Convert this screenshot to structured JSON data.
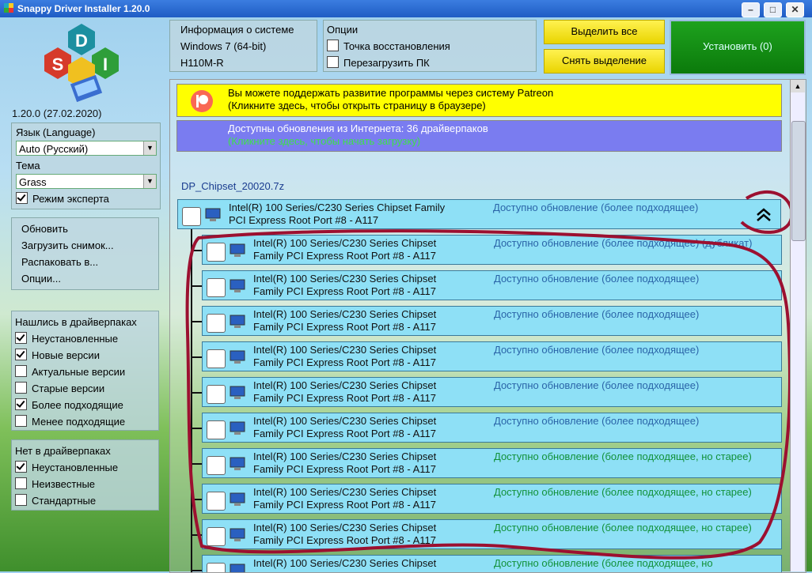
{
  "window": {
    "title": "Snappy Driver Installer 1.20.0",
    "controls": [
      "–",
      "□",
      "✕"
    ]
  },
  "version": "1.20.0 (27.02.2020)",
  "sysinfo": {
    "header": "Информация о системе",
    "os": "Windows 7 (64-bit)",
    "board": "H110M-R"
  },
  "options": {
    "header": "Опции",
    "restore_point": "Точка восстановления",
    "reboot": "Перезагрузить ПК"
  },
  "buttons": {
    "select_all": "Выделить все",
    "deselect": "Снять выделение",
    "install": "Установить (0)"
  },
  "language": {
    "label": "Язык (Language)",
    "value": "Auto (Русский)"
  },
  "theme": {
    "label": "Тема",
    "value": "Grass"
  },
  "expert_mode": "Режим эксперта",
  "menu": [
    "Обновить",
    "Загрузить снимок...",
    "Распаковать в...",
    "Опции..."
  ],
  "found": {
    "header": "Нашлись в драйверпаках",
    "items": [
      {
        "label": "Неустановленные",
        "checked": true
      },
      {
        "label": "Новые версии",
        "checked": true
      },
      {
        "label": "Актуальные версии",
        "checked": false
      },
      {
        "label": "Старые версии",
        "checked": false
      },
      {
        "label": "Более подходящие",
        "checked": true
      },
      {
        "label": "Менее подходящие",
        "checked": false
      }
    ]
  },
  "notfound": {
    "header": "Нет в драйверпаках",
    "items": [
      {
        "label": "Неустановленные",
        "checked": true
      },
      {
        "label": "Неизвестные",
        "checked": false
      },
      {
        "label": "Стандартные",
        "checked": false
      }
    ]
  },
  "patreon": {
    "line1": "Вы можете поддержать развитие программы через систему Patreon",
    "line2": "(Кликните здесь, чтобы открыть страницу в браузере)"
  },
  "updates": {
    "line1": "Доступны обновления из Интернета: 36 драйверпаков",
    "line2": "(Кликните здесь, чтобы начать загрузку)"
  },
  "driverpack": "DP_Chipset_20020.7z",
  "group": {
    "line1": "Intel(R) 100 Series/C230 Series Chipset Family",
    "line2": "PCI Express Root Port #8 - A117",
    "status": "Доступно обновление (более подходящее)"
  },
  "drivers": [
    {
      "line1": "Intel(R) 100 Series/C230 Series Chipset",
      "line2": "Family PCI Express Root Port #8 - A117",
      "status": "Доступно обновление (более подходящее) (дубликат)",
      "color": "blue"
    },
    {
      "line1": "Intel(R) 100 Series/C230 Series Chipset",
      "line2": "Family PCI Express Root Port #8 - A117",
      "status": "Доступно обновление (более подходящее)",
      "color": "blue"
    },
    {
      "line1": "Intel(R) 100 Series/C230 Series Chipset",
      "line2": "Family PCI Express Root Port #8 - A117",
      "status": "Доступно обновление (более подходящее)",
      "color": "blue"
    },
    {
      "line1": "Intel(R) 100 Series/C230 Series Chipset",
      "line2": "Family PCI Express Root Port #8 - A117",
      "status": "Доступно обновление (более подходящее)",
      "color": "blue"
    },
    {
      "line1": "Intel(R) 100 Series/C230 Series Chipset",
      "line2": "Family PCI Express Root Port #8 - A117",
      "status": "Доступно обновление (более подходящее)",
      "color": "blue"
    },
    {
      "line1": "Intel(R) 100 Series/C230 Series Chipset",
      "line2": "Family PCI Express Root Port #8 - A117",
      "status": "Доступно обновление (более подходящее)",
      "color": "blue"
    },
    {
      "line1": "Intel(R) 100 Series/C230 Series Chipset",
      "line2": "Family PCI Express Root Port #8 - A117",
      "status": "Доступно обновление (более подходящее, но старее)",
      "color": "green"
    },
    {
      "line1": "Intel(R) 100 Series/C230 Series Chipset",
      "line2": "Family PCI Express Root Port #8 - A117",
      "status": "Доступно обновление (более подходящее, но старее)",
      "color": "green"
    },
    {
      "line1": "Intel(R) 100 Series/C230 Series Chipset",
      "line2": "Family PCI Express Root Port #8 - A117",
      "status": "Доступно обновление (более подходящее, но старее)",
      "color": "green"
    },
    {
      "line1": "Intel(R) 100 Series/C230 Series Chipset",
      "line2": "",
      "status": "Доступно обновление (более подходящее, но",
      "color": "green"
    }
  ]
}
